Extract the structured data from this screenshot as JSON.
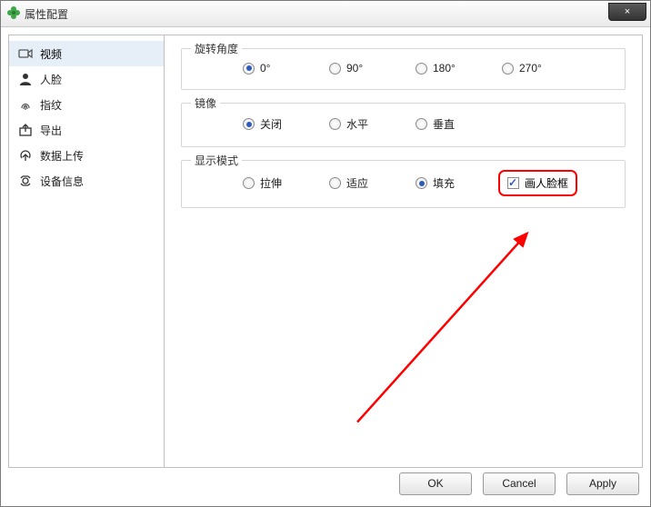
{
  "window": {
    "title": "属性配置",
    "close_label": "×"
  },
  "sidebar": {
    "items": [
      {
        "label": "视频",
        "icon": "camera-icon",
        "selected": true
      },
      {
        "label": "人脸",
        "icon": "face-icon",
        "selected": false
      },
      {
        "label": "指纹",
        "icon": "fingerprint-icon",
        "selected": false
      },
      {
        "label": "导出",
        "icon": "export-icon",
        "selected": false
      },
      {
        "label": "数据上传",
        "icon": "upload-icon",
        "selected": false
      },
      {
        "label": "设备信息",
        "icon": "info-icon",
        "selected": false
      }
    ]
  },
  "content": {
    "rotation": {
      "legend": "旋转角度",
      "options": [
        "0°",
        "90°",
        "180°",
        "270°"
      ],
      "selected": 0
    },
    "mirror": {
      "legend": "镜像",
      "options": [
        "关闭",
        "水平",
        "垂直"
      ],
      "selected": 0
    },
    "display": {
      "legend": "显示模式",
      "options": [
        "拉伸",
        "适应",
        "填充"
      ],
      "selected": 2,
      "facebox_label": "画人脸框",
      "facebox_checked": true
    }
  },
  "footer": {
    "ok": "OK",
    "cancel": "Cancel",
    "apply": "Apply"
  }
}
